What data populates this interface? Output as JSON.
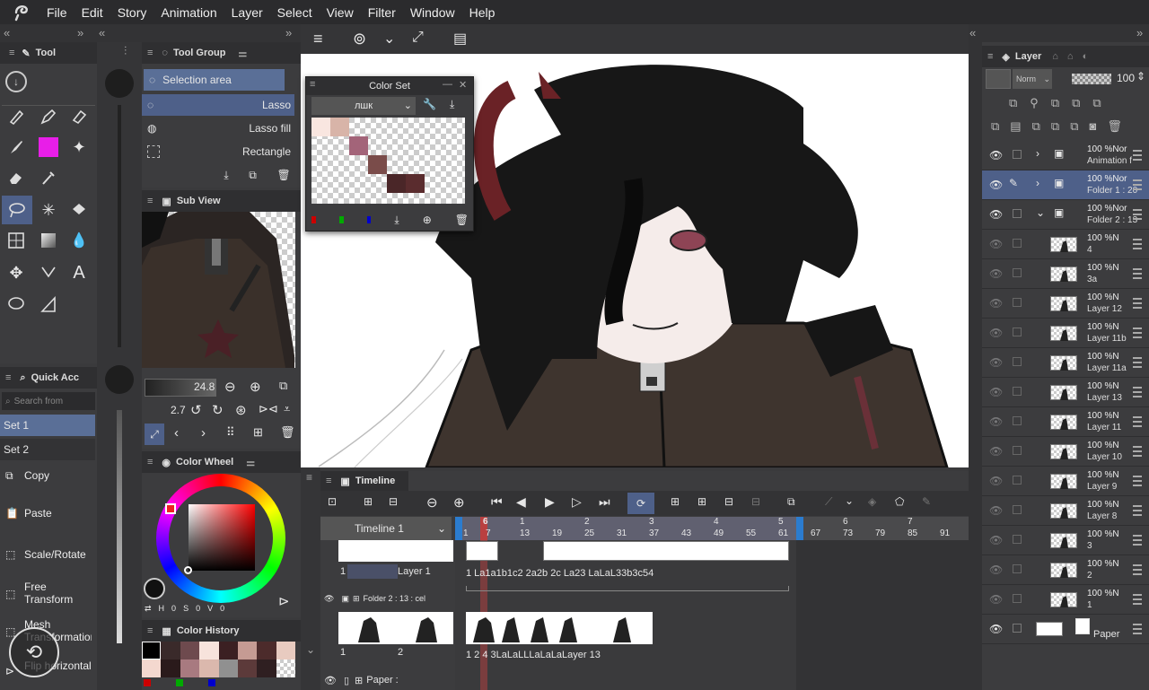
{
  "menu": [
    "File",
    "Edit",
    "Story",
    "Animation",
    "Layer",
    "Select",
    "View",
    "Filter",
    "Window",
    "Help"
  ],
  "tool_panel": {
    "title": "Tool"
  },
  "tool_group": {
    "title": "Tool Group",
    "selection_label": "Selection area",
    "items": [
      "Lasso",
      "Lasso fill",
      "Rectangle"
    ]
  },
  "color_set": {
    "title": "Color Set",
    "set_name": "лшк"
  },
  "sub_view": {
    "title": "Sub View"
  },
  "sub_tool": {
    "brush_size": "24.8",
    "rotate_value": "2.7"
  },
  "quick_access": {
    "title": "Quick Acc",
    "search_placeholder": "Search from",
    "sets": [
      "Set 1",
      "Set 2"
    ],
    "items": [
      "Copy",
      "Paste",
      "Scale/Rotate",
      "Free Transform",
      "Mesh Transformation",
      "Flip horizontal"
    ]
  },
  "color_wheel": {
    "title": "Color Wheel",
    "h_label": "H",
    "h_value": "0",
    "s_label": "S",
    "s_value": "0",
    "v_label": "V",
    "v_value": "0"
  },
  "color_history": {
    "title": "Color History"
  },
  "timeline": {
    "title": "Timeline",
    "name": "Timeline 1",
    "ruler_seconds": [
      "1",
      "2",
      "3",
      "4",
      "5",
      "6",
      "7"
    ],
    "ruler_frames": [
      "1",
      "13",
      "19",
      "25",
      "31",
      "37",
      "43",
      "49",
      "55",
      "61",
      "67",
      "73",
      "79",
      "85",
      "91"
    ],
    "playhead_frame": "6",
    "playhead_sub": "7",
    "track1": {
      "name": "Layer 1",
      "cel_num": "1",
      "cels": "1 La1a1b1c2 2a2b 2c La23 LaLaL33b3c54"
    },
    "track2": {
      "name": "Folder 2 : 13 : cel",
      "cel1": "1",
      "cel2": "2",
      "cels": "1 2 4 3LaLaLLLaLaLaLayer 13"
    },
    "track3": {
      "name": "Paper :"
    }
  },
  "layer_panel": {
    "title": "Layer",
    "blend_mode": "Norm",
    "opacity": "100",
    "layers": [
      {
        "pct": "100 %Nor",
        "name": "Animation f",
        "type": "anim"
      },
      {
        "pct": "100 %Nor",
        "name": "Folder 1 : 20",
        "type": "folder"
      },
      {
        "pct": "100 %Nor",
        "name": "Folder 2 : 13",
        "type": "folder"
      },
      {
        "pct": "100 %N",
        "name": "4",
        "type": "layer"
      },
      {
        "pct": "100 %N",
        "name": "3a",
        "type": "layer"
      },
      {
        "pct": "100 %N",
        "name": "Layer 12",
        "type": "layer"
      },
      {
        "pct": "100 %N",
        "name": "Layer 11b",
        "type": "layer"
      },
      {
        "pct": "100 %N",
        "name": "Layer 11a",
        "type": "layer"
      },
      {
        "pct": "100 %N",
        "name": "Layer 13",
        "type": "layer"
      },
      {
        "pct": "100 %N",
        "name": "Layer 11",
        "type": "layer"
      },
      {
        "pct": "100 %N",
        "name": "Layer 10",
        "type": "layer"
      },
      {
        "pct": "100 %N",
        "name": "Layer 9",
        "type": "layer"
      },
      {
        "pct": "100 %N",
        "name": "Layer 8",
        "type": "layer"
      },
      {
        "pct": "100 %N",
        "name": "3",
        "type": "layer"
      },
      {
        "pct": "100 %N",
        "name": "2",
        "type": "layer"
      },
      {
        "pct": "100 %N",
        "name": "1",
        "type": "layer"
      }
    ],
    "paper": "Paper"
  },
  "colors": {
    "accent": "#5a6f97",
    "panel": "#3c3c3e",
    "header": "#2f2f31",
    "selected": "#4e6089"
  }
}
